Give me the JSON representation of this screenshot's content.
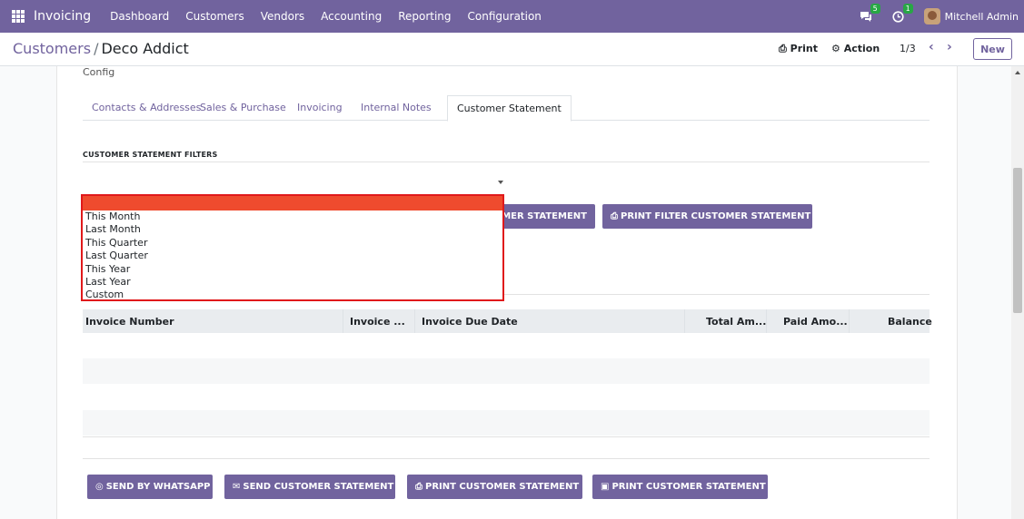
{
  "navbar": {
    "app_name": "Invoicing",
    "menu": [
      "Dashboard",
      "Customers",
      "Vendors",
      "Accounting",
      "Reporting",
      "Configuration"
    ],
    "messages_count": "5",
    "activities_count": "1",
    "user": "Mitchell Admin"
  },
  "control_panel": {
    "breadcrumb_parent": "Customers",
    "breadcrumb_separator": "/",
    "breadcrumb_current": "Deco Addict",
    "print_label": "Print",
    "action_label": "Action",
    "pager": "1/3",
    "new_label": "New"
  },
  "form": {
    "config_label": "Config",
    "tabs": [
      "Contacts & Addresses",
      "Sales & Purchase",
      "Invoicing",
      "Internal Notes",
      "Customer Statement"
    ],
    "active_tab": "Customer Statement",
    "filters_title": "CUSTOMER STATEMENT FILTERS",
    "filter_buttons": [
      "MER STATEMENT",
      "PRINT FILTER CUSTOMER STATEMENT"
    ],
    "table_headers": [
      "Invoice Number",
      "Invoice ...",
      "Invoice Due Date",
      "Total Am...",
      "Paid Amo...",
      "Balance"
    ],
    "bottom_buttons": [
      "SEND BY WHATSAPP",
      "SEND CUSTOMER STATEMENT",
      "PRINT CUSTOMER STATEMENT",
      "PRINT CUSTOMER STATEMENT"
    ]
  },
  "dropdown": {
    "selected": "",
    "options": [
      "This Month",
      "Last Month",
      "This Quarter",
      "Last Quarter",
      "This Year",
      "Last Year",
      "Custom"
    ]
  },
  "colors": {
    "brand": "#71639e",
    "highlight_border": "#e0191b",
    "selected_option": "#ef4b2e",
    "badge": "#28a745"
  }
}
